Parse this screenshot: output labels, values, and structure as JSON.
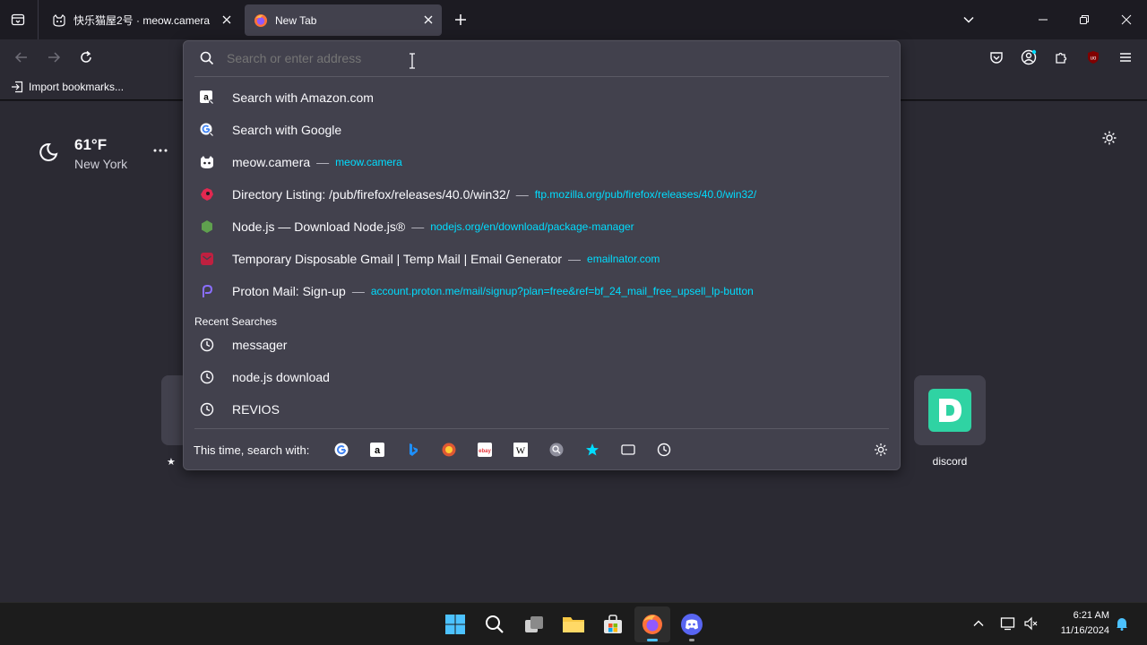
{
  "tabs": [
    {
      "title": "快乐猫屋2号 · meow.camera"
    },
    {
      "title": "New Tab"
    }
  ],
  "bookmarks": {
    "import_label": "Import bookmarks..."
  },
  "weather": {
    "temp": "61°F",
    "city": "New York"
  },
  "urlbar": {
    "placeholder": "Search or enter address",
    "results": [
      {
        "title": "Search with Amazon.com",
        "url": "",
        "icon": "amazon-icon"
      },
      {
        "title": "Search with Google",
        "url": "",
        "icon": "google-icon"
      },
      {
        "title": "meow.camera",
        "url": "meow.camera",
        "icon": "cat-icon"
      },
      {
        "title": "Directory Listing: /pub/firefox/releases/40.0/win32/",
        "url": "ftp.mozilla.org/pub/firefox/releases/40.0/win32/",
        "icon": "mozilla-icon"
      },
      {
        "title": "Node.js — Download Node.js®",
        "url": "nodejs.org/en/download/package-manager",
        "icon": "nodejs-icon"
      },
      {
        "title": "Temporary Disposable Gmail | Temp Mail | Email Generator",
        "url": "emailnator.com",
        "icon": "mail-icon"
      },
      {
        "title": "Proton Mail: Sign-up",
        "url": "account.proton.me/mail/signup?plan=free&ref=bf_24_mail_free_upsell_lp-button",
        "icon": "proton-icon"
      }
    ],
    "recent_header": "Recent Searches",
    "recent": [
      "messager",
      "node.js download",
      "REVIOS"
    ],
    "search_with_label": "This time, search with:",
    "separator": "—"
  },
  "shortcuts": {
    "discord_label": "discord"
  },
  "clock": {
    "time": "6:21 AM",
    "date": "11/16/2024"
  },
  "colors": {
    "accent": "#00ddff",
    "bg": "#2b2a33",
    "popup": "#42414d"
  }
}
